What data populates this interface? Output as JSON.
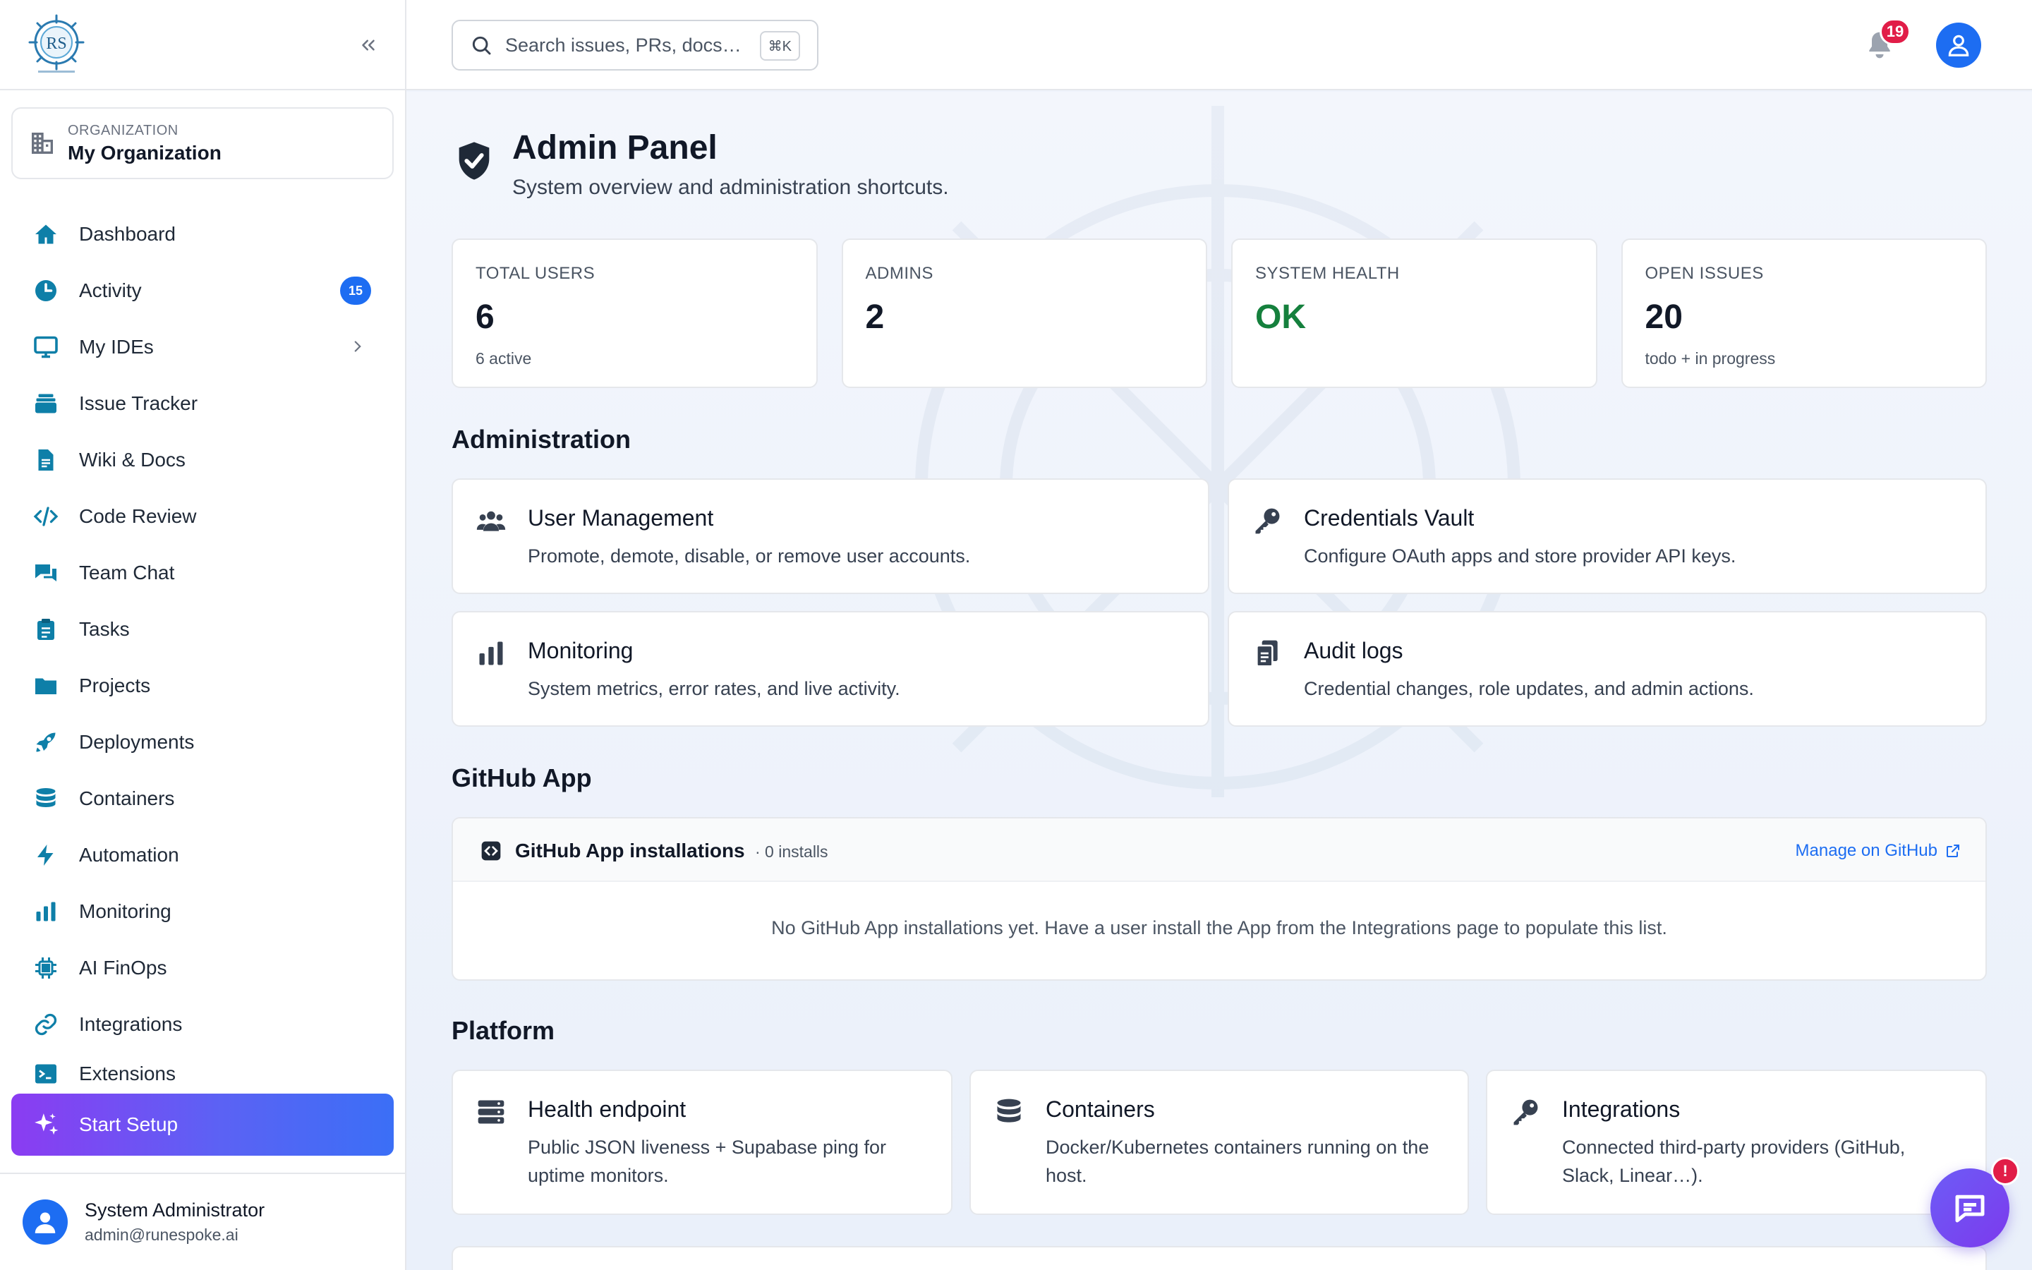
{
  "sidebar": {
    "org_label": "ORGANIZATION",
    "org_name": "My Organization",
    "nav": [
      {
        "label": "Dashboard",
        "icon": "home-icon"
      },
      {
        "label": "Activity",
        "icon": "clock-icon",
        "badge": "15"
      },
      {
        "label": "My IDEs",
        "icon": "monitor-icon"
      },
      {
        "label": "Issue Tracker",
        "icon": "layers-icon"
      },
      {
        "label": "Wiki & Docs",
        "icon": "document-icon"
      },
      {
        "label": "Code Review",
        "icon": "code-icon"
      },
      {
        "label": "Team Chat",
        "icon": "chat-icon"
      },
      {
        "label": "Tasks",
        "icon": "clipboard-icon"
      },
      {
        "label": "Projects",
        "icon": "folder-icon"
      },
      {
        "label": "Deployments",
        "icon": "rocket-icon"
      },
      {
        "label": "Containers",
        "icon": "database-icon"
      },
      {
        "label": "Automation",
        "icon": "bolt-icon"
      },
      {
        "label": "Monitoring",
        "icon": "bar-chart-icon"
      },
      {
        "label": "AI FinOps",
        "icon": "chip-icon"
      },
      {
        "label": "Integrations",
        "icon": "link-icon"
      },
      {
        "label": "Extensions",
        "icon": "terminal-icon"
      }
    ],
    "setup_label": "Start Setup",
    "user_name": "System Administrator",
    "user_email": "admin@runespoke.ai"
  },
  "header": {
    "search_placeholder": "Search issues, PRs, docs…",
    "shortcut": "⌘K",
    "notification_count": "19"
  },
  "page": {
    "title": "Admin Panel",
    "subtitle": "System overview and administration shortcuts."
  },
  "stats": [
    {
      "label": "TOTAL USERS",
      "value": "6",
      "sub": "6 active"
    },
    {
      "label": "ADMINS",
      "value": "2",
      "sub": ""
    },
    {
      "label": "SYSTEM HEALTH",
      "value": "OK",
      "sub": ""
    },
    {
      "label": "OPEN ISSUES",
      "value": "20",
      "sub": "todo + in progress"
    }
  ],
  "administration": {
    "title": "Administration",
    "cards": [
      {
        "title": "User Management",
        "desc": "Promote, demote, disable, or remove user accounts."
      },
      {
        "title": "Credentials Vault",
        "desc": "Configure OAuth apps and store provider API keys."
      },
      {
        "title": "Monitoring",
        "desc": "System metrics, error rates, and live activity."
      },
      {
        "title": "Audit logs",
        "desc": "Credential changes, role updates, and admin actions."
      }
    ]
  },
  "github": {
    "section_title": "GitHub App",
    "panel_title": "GitHub App installations",
    "count": "· 0 installs",
    "manage_link": "Manage on GitHub",
    "empty": "No GitHub App installations yet. Have a user install the App from the Integrations page to populate this list."
  },
  "platform": {
    "title": "Platform",
    "cards": [
      {
        "title": "Health endpoint",
        "desc1": "Public JSON liveness + Supabase ping for",
        "desc2": "uptime monitors."
      },
      {
        "title": "Containers",
        "desc1": "Docker/Kubernetes containers running on the",
        "desc2": "host."
      },
      {
        "title": "Integrations",
        "desc1": "Connected third-party providers (GitHub,",
        "desc2": "Slack, Linear…)."
      }
    ]
  },
  "chat_badge": "!",
  "colors": {
    "accent": "#1d6df2",
    "nav_icon": "#0e7fa8",
    "health_ok": "#15803d",
    "badge_red": "#e11d48",
    "setup_gradient_start": "#8b3cf2",
    "setup_gradient_end": "#3b6ff6"
  }
}
